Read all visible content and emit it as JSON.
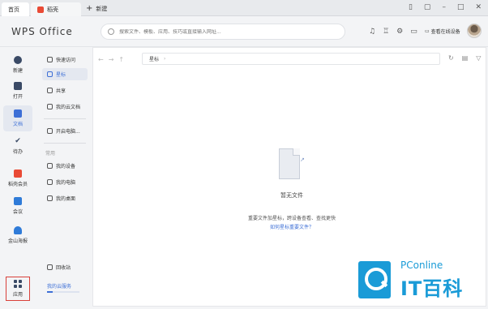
{
  "tabs": {
    "home": "首页",
    "daoke": "稻壳",
    "new_tab": "新建"
  },
  "header": {
    "logo": "WPS Office",
    "search_placeholder": "搜索文件、模板、应用、技巧或直接输入网址...",
    "view_device": "查看在线设备"
  },
  "rail": {
    "new": "新建",
    "open": "打开",
    "docs": "文档",
    "todo": "待办",
    "member": "稻壳会员",
    "meeting": "会议",
    "jinshan": "金山海报",
    "apps": "应用"
  },
  "nav": {
    "quick": "快速访问",
    "star": "星标",
    "share": "共享",
    "cloud_docs": "我的云文档",
    "open_computer": "开启电脑...",
    "common": "常用",
    "my_device": "我的设备",
    "my_computer": "我的电脑",
    "my_desktop": "我的桌面",
    "recycle": "回收站",
    "cloud_service": "我的云服务"
  },
  "cloud_usage_fraction": 0.18,
  "main": {
    "breadcrumb": "星标",
    "empty_title": "暂无文件",
    "empty_hint": "重要文件加星标，跨设备查看、查找更快",
    "empty_link": "如何星标重要文件？"
  },
  "watermark": {
    "top": "PConline",
    "bottom": "IT百科"
  },
  "colors": {
    "accent": "#3d6fd6",
    "highlight_box": "#d9403a",
    "watermark": "#1a9bd7"
  }
}
